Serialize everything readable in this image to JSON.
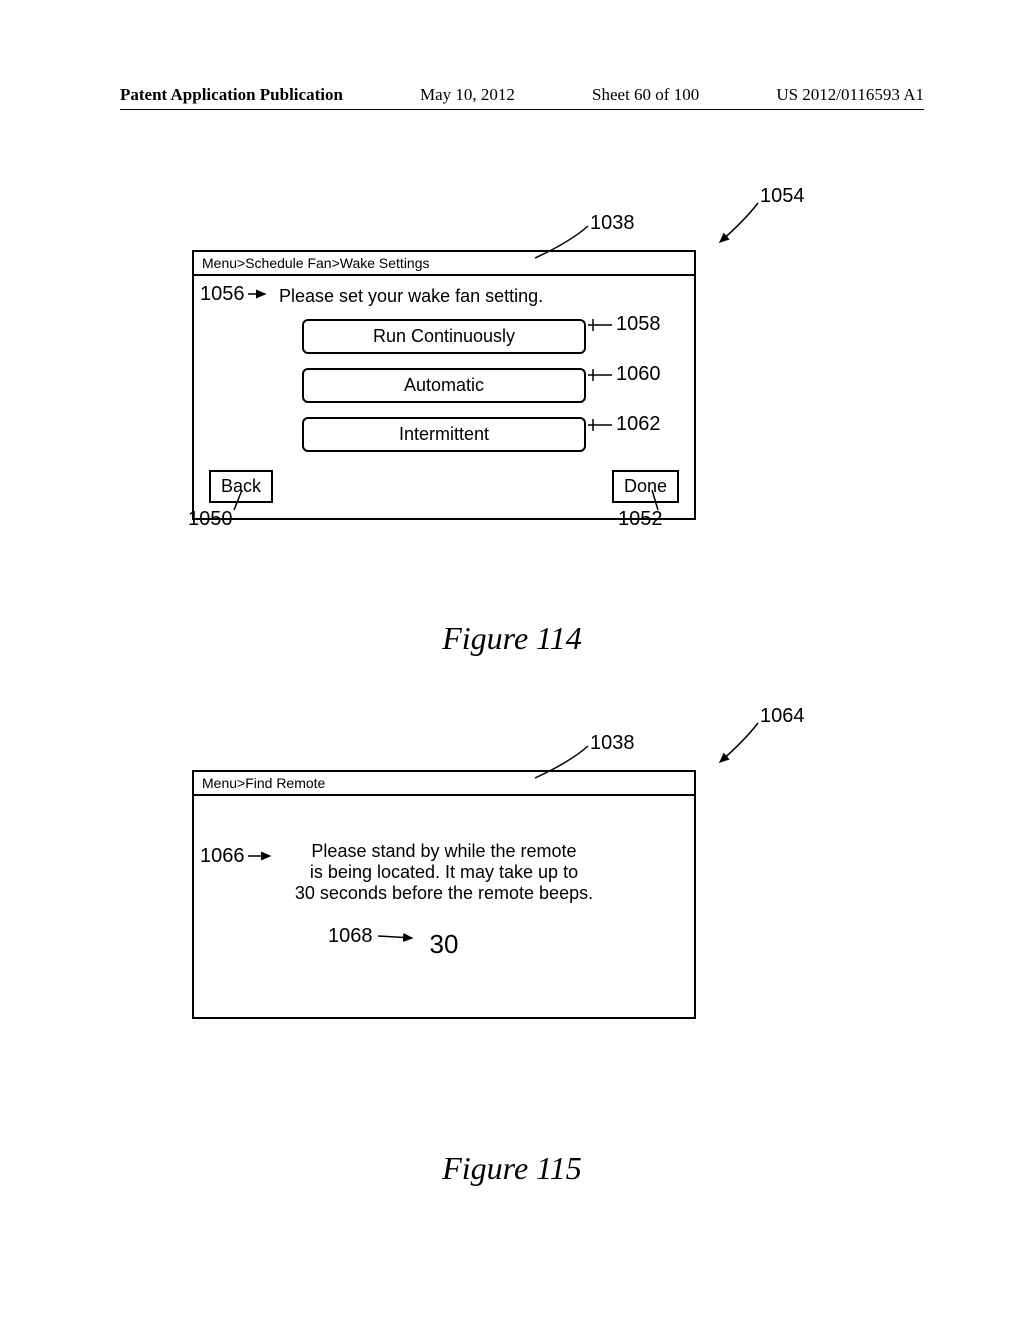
{
  "header": {
    "left": "Patent Application Publication",
    "date": "May 10, 2012",
    "sheet": "Sheet 60 of 100",
    "docnum": "US 2012/0116593 A1"
  },
  "fig114": {
    "breadcrumb": "Menu>Schedule Fan>Wake Settings",
    "prompt": "Please set your wake fan setting.",
    "option1": "Run Continuously",
    "option2": "Automatic",
    "option3": "Intermittent",
    "back": "Back",
    "done": "Done",
    "caption": "Figure 114",
    "labels": {
      "screen": "1054",
      "title": "1038",
      "prompt": "1056",
      "opt1": "1058",
      "opt2": "1060",
      "opt3": "1062",
      "back": "1050",
      "done": "1052"
    }
  },
  "fig115": {
    "breadcrumb": "Menu>Find Remote",
    "message_line1": "Please stand by while the remote",
    "message_line2": "is being located. It may take up to",
    "message_line3": "30 seconds before the remote beeps.",
    "countdown": "30",
    "caption": "Figure 115",
    "labels": {
      "screen": "1064",
      "title": "1038",
      "message": "1066",
      "countdown": "1068"
    }
  }
}
